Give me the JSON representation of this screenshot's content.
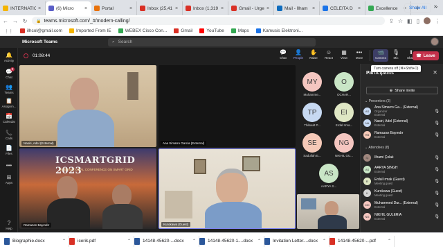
{
  "browser": {
    "tabs": [
      {
        "title": "INTERNATIO",
        "color": "#f4b400",
        "active": false
      },
      {
        "title": "(6) Micro",
        "color": "#5b5fc7",
        "active": true
      },
      {
        "title": "Portal",
        "color": "#e8710a",
        "active": false
      },
      {
        "title": "Inbox (25,41",
        "color": "#d93025",
        "active": false
      },
      {
        "title": "Inbox (1,319",
        "color": "#d93025",
        "active": false
      },
      {
        "title": "Gmail - Urge",
        "color": "#d93025",
        "active": false
      },
      {
        "title": "Mail - İlham",
        "color": "#0f6cbd",
        "active": false
      },
      {
        "title": "CELEITA D",
        "color": "#1a73e8",
        "active": false
      },
      {
        "title": "Excellence",
        "color": "#34a853",
        "active": false
      }
    ],
    "new_tab": "+",
    "url": "teams.microsoft.com/_#/modern-calling/",
    "bookmarks": [
      {
        "label": "ilhcol@gmail.com",
        "color": "#d93025"
      },
      {
        "label": "Imported From IE",
        "color": "#f4b400"
      },
      {
        "label": "WEBEX Cisco Con...",
        "color": "#34a853"
      },
      {
        "label": "Gmail",
        "color": "#d93025"
      },
      {
        "label": "YouTube",
        "color": "#ff0000"
      },
      {
        "label": "Maps",
        "color": "#34a853"
      },
      {
        "label": "Kamusis Elektroni...",
        "color": "#1a73e8"
      }
    ]
  },
  "teams": {
    "app_name": "Microsoft Teams",
    "search_placeholder": "Search",
    "rail": [
      {
        "icon": "activity-icon",
        "glyph": "🔔",
        "label": "Activity"
      },
      {
        "icon": "chat-icon",
        "glyph": "💬",
        "label": "Chat",
        "badge": "9"
      },
      {
        "icon": "teams-icon",
        "glyph": "👥",
        "label": "Teams"
      },
      {
        "icon": "assignments-icon",
        "glyph": "📋",
        "label": "Assignm..."
      },
      {
        "icon": "calendar-icon",
        "glyph": "📅",
        "label": "Calendar"
      },
      {
        "icon": "calls-icon",
        "glyph": "📞",
        "label": "Calls"
      },
      {
        "icon": "files-icon",
        "glyph": "📄",
        "label": "Files"
      },
      {
        "icon": "more-icon",
        "glyph": "•••",
        "label": ""
      },
      {
        "icon": "apps-icon",
        "glyph": "⊞",
        "label": "Apps"
      },
      {
        "icon": "help-icon",
        "glyph": "?",
        "label": "Help"
      }
    ],
    "meeting": {
      "timer": "01:08:44",
      "controls": [
        {
          "name": "chat",
          "glyph": "💬",
          "label": "Chat"
        },
        {
          "name": "people",
          "glyph": "👤",
          "label": "People"
        },
        {
          "name": "raise",
          "glyph": "✋",
          "label": "Raise"
        },
        {
          "name": "react",
          "glyph": "☺",
          "label": "React"
        },
        {
          "name": "view",
          "glyph": "▦",
          "label": "View"
        },
        {
          "name": "more",
          "glyph": "•••",
          "label": "More"
        },
        {
          "name": "camera",
          "glyph": "📹",
          "label": "Camera"
        },
        {
          "name": "mic",
          "glyph": "🎙",
          "label": "Mic"
        },
        {
          "name": "share",
          "glyph": "⬆",
          "label": "Share"
        }
      ],
      "leave_label": "Leave",
      "camera_tooltip": "Turn camera off (⌘+Shift+O)"
    },
    "tiles": [
      {
        "name": "Nasiri, Adel (External)"
      },
      {
        "name": "Ana Simarro Garcia (External)"
      },
      {
        "name": "Ramazan Bayındır"
      },
      {
        "name": "Kurokawa (Guest)"
      },
      {
        "name": ""
      }
    ],
    "conference_banner": "ICSMARTGRID 2023",
    "conference_sub": "INTERNATIONAL CONFERENCE ON SMART GRID",
    "avatars": [
      {
        "initials": "MY",
        "name": "Muhamme...",
        "color": "#f4c6c0"
      },
      {
        "initials": "O",
        "name": "OCHAR...",
        "color": "#c9e6c6"
      },
      {
        "initials": "TP",
        "name": "Thibault P...",
        "color": "#c7d9f2"
      },
      {
        "initials": "EI",
        "name": "Erdal Irma...",
        "color": "#dfe7c4"
      },
      {
        "initials": "SE",
        "name": "Sadullah E...",
        "color": "#f5c9b8"
      },
      {
        "initials": "NG",
        "name": "NIKHIL GU...",
        "color": "#f4c6c0"
      },
      {
        "initials": "AS",
        "name": "AARYA S...",
        "color": "#c9e6c6"
      }
    ],
    "panel": {
      "title": "Participants",
      "share_invite": "Share invite",
      "presenters_header": "Presenters (3)",
      "attendees_header": "Attendees (8)",
      "presenters": [
        {
          "initials": "AS",
          "name": "Ana Simarro Ga... (External)",
          "role": "Organizer",
          "role2": "External",
          "color": "#c7d9f2"
        },
        {
          "initials": "NA",
          "name": "Nasiri, Adel (External)",
          "role": "External",
          "role2": "",
          "color": "#c7d9f2"
        },
        {
          "initials": "RB",
          "name": "Ramazan Bayındır",
          "role": "External",
          "role2": "",
          "color": "#f5c9b8"
        }
      ],
      "attendees": [
        {
          "initials": "İÇ",
          "name": "İlhami Çolak",
          "role": "",
          "color": "#a1887f"
        },
        {
          "initials": "AS",
          "name": "AARYA SINGH",
          "role": "External",
          "color": "#c9e6c6"
        },
        {
          "initials": "EI",
          "name": "Erdal Irmak (Guest)",
          "role": "Meeting guest",
          "color": "#dfe7c4"
        },
        {
          "initials": "K",
          "name": "Kurokawa (Guest)",
          "role": "Meeting guest",
          "color": "#d6d6d6"
        },
        {
          "initials": "MD",
          "name": "Muhammed Dur... (External)",
          "role": "External",
          "color": "#f4c6c0"
        },
        {
          "initials": "NG",
          "name": "NIKHIL GULERIA",
          "role": "External",
          "color": "#f4c6c0"
        }
      ]
    }
  },
  "downloads": {
    "items": [
      {
        "name": "Biographie.docx",
        "color": "#2b579a"
      },
      {
        "name": "icerik.pdf",
        "color": "#d93025"
      },
      {
        "name": "14148-45620-...docx",
        "color": "#2b579a"
      },
      {
        "name": "14148-45620-1....docx",
        "color": "#2b579a"
      },
      {
        "name": "Invitation Letter....docx",
        "color": "#2b579a"
      },
      {
        "name": "14148-45620-...pdf",
        "color": "#d93025"
      }
    ],
    "show_all": "Show All"
  }
}
